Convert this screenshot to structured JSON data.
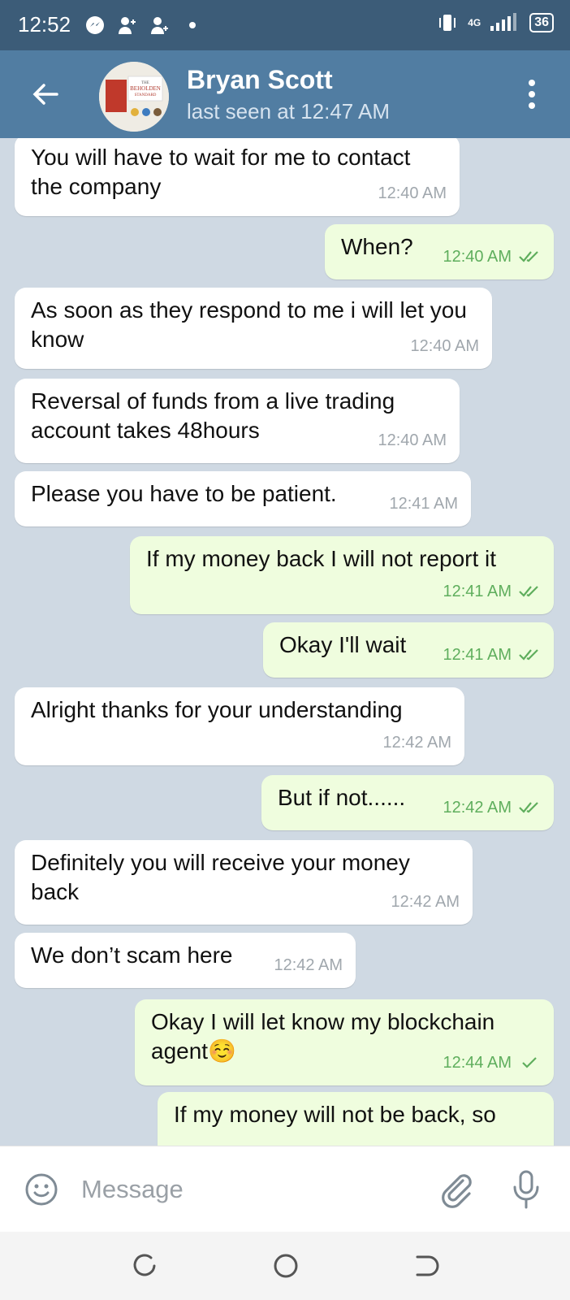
{
  "status_bar": {
    "time": "12:52",
    "network": "4G",
    "battery": "36"
  },
  "header": {
    "contact_name": "Bryan Scott",
    "last_seen": "last seen at 12:47 AM",
    "avatar_text": [
      "THE",
      "BEHOLDEN",
      "STANDARD"
    ]
  },
  "messages": [
    {
      "dir": "in",
      "text": "You will have to wait for me to contact the company",
      "time": "12:40 AM"
    },
    {
      "dir": "out",
      "text": "When?",
      "time": "12:40 AM",
      "status": "read"
    },
    {
      "dir": "in",
      "text": "As soon as they respond to me i will let you know",
      "time": "12:40 AM"
    },
    {
      "dir": "in",
      "text": "Reversal of funds from a live trading account takes 48hours",
      "time": "12:40 AM"
    },
    {
      "dir": "in",
      "text": "Please you have to be patient.",
      "time": "12:41 AM"
    },
    {
      "dir": "out",
      "text": "If my money back I will not report it",
      "time": "12:41 AM",
      "status": "read"
    },
    {
      "dir": "out",
      "text": "Okay I'll wait",
      "time": "12:41 AM",
      "status": "read"
    },
    {
      "dir": "in",
      "text": "Alright thanks for your understanding",
      "time": "12:42 AM"
    },
    {
      "dir": "out",
      "text": "But if not......",
      "time": "12:42 AM",
      "status": "read"
    },
    {
      "dir": "in",
      "text": "Definitely you will receive your money back",
      "time": "12:42 AM"
    },
    {
      "dir": "in",
      "text": "We don’t scam here",
      "time": "12:42 AM"
    },
    {
      "dir": "out",
      "text": "Okay I will let know my blockchain agent☺️",
      "time": "12:44 AM",
      "status": "sent"
    },
    {
      "dir": "out",
      "text": "If my money will not be back, so",
      "time": "",
      "status": ""
    }
  ],
  "input": {
    "placeholder": "Message"
  },
  "icons": {
    "back": "back-arrow-icon",
    "menu": "more-vertical-icon",
    "emoji": "emoji-icon",
    "attach": "paperclip-icon",
    "mic": "microphone-icon",
    "nav_recent": "recent-apps-icon",
    "nav_home": "home-icon",
    "nav_back": "back-nav-icon"
  },
  "colors": {
    "header": "#517da2",
    "status_bar": "#3c5c78",
    "chat_bg": "#cfd9e3",
    "out_bubble": "#effdde",
    "in_bubble": "#ffffff",
    "read_tick": "#5fae5d"
  }
}
